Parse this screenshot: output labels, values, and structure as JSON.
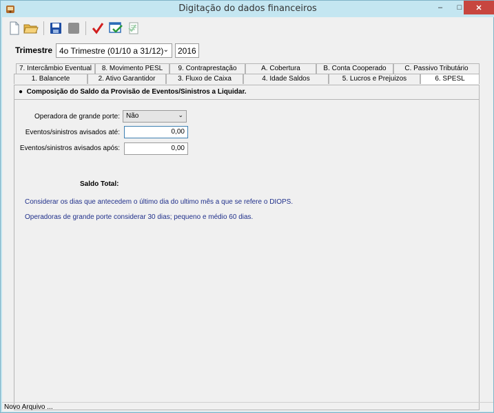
{
  "window": {
    "title": "Digitação do dados financeiros",
    "minimize_label": "–",
    "maximize_label": "□",
    "close_label": "✕"
  },
  "toolbar": {
    "buttons": [
      "new-file-icon",
      "open-folder-icon",
      "save-icon",
      "disabled-icon",
      "check-icon",
      "validate-icon",
      "report-icon"
    ]
  },
  "period": {
    "label": "Trimestre",
    "selected": "4o Trimestre (01/10 a 31/12)",
    "year": "2016"
  },
  "tabs": {
    "row1": [
      "7. Intercâmbio Eventual",
      "8. Movimento PESL",
      "9. Contraprestação",
      "A. Cobertura",
      "B. Conta Cooperado",
      "C. Passivo Tributário"
    ],
    "row2": [
      "1. Balancete",
      "2. Ativo Garantidor",
      "3. Fluxo de Caixa",
      "4. Idade Saldos",
      "5. Lucros e Prejuizos",
      "6. SPESL"
    ]
  },
  "spesl": {
    "section_title": "Composição do Saldo da Provisão de Eventos/Sinistros a Liquidar.",
    "operadora_label": "Operadora de grande porte:",
    "operadora_value": "Não",
    "avisados_ate_label": "Eventos/sinistros avisados até:",
    "avisados_ate_value": "0,00",
    "avisados_apos_label": "Eventos/sinistros avisados após:",
    "avisados_apos_value": "0,00",
    "saldo_total_label": "Saldo Total:",
    "note1": "Considerar os dias que antecedem o último dia do ultimo mês a que se refere o DIOPS.",
    "note2": "Operadoras de grande porte considerar 30 dias; pequeno e médio 60 dias."
  },
  "status": {
    "text": "Novo Arquivo ..."
  },
  "colors": {
    "titlebar": "#c4e6f1",
    "close_button": "#c7463f",
    "note_text": "#1f2f8a",
    "check_red": "#d11f1f"
  }
}
